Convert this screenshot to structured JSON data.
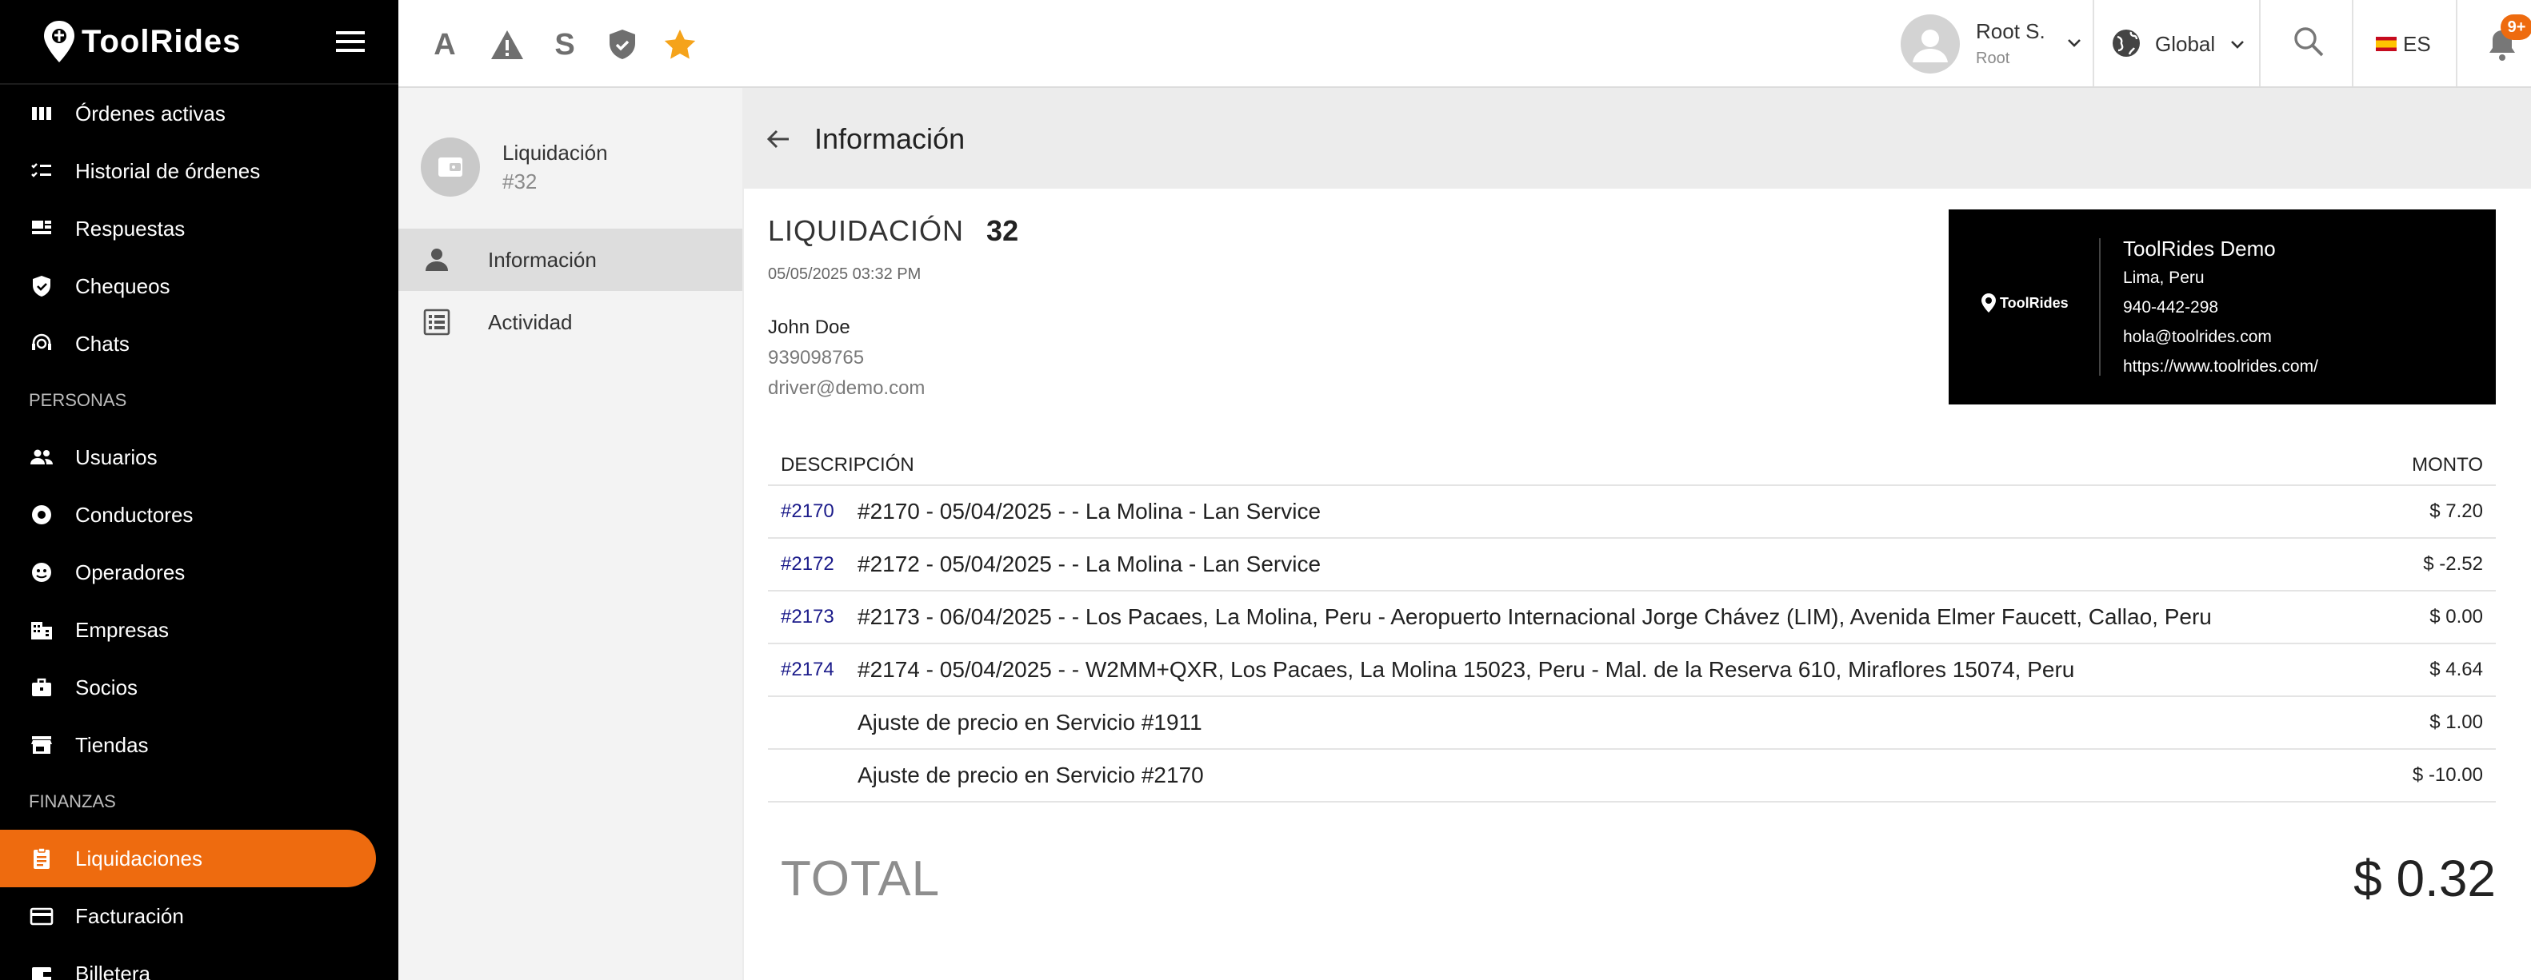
{
  "app": {
    "name": "ToolRides"
  },
  "sidebar": {
    "items_top": [
      {
        "label": "Órdenes activas",
        "icon": "columns-icon"
      },
      {
        "label": "Historial de órdenes",
        "icon": "checklist-icon"
      },
      {
        "label": "Respuestas",
        "icon": "reviews-icon"
      },
      {
        "label": "Chequeos",
        "icon": "shield-check-icon"
      },
      {
        "label": "Chats",
        "icon": "support-agent-icon"
      }
    ],
    "section_people": "PERSONAS",
    "items_people": [
      {
        "label": "Usuarios",
        "icon": "people-icon"
      },
      {
        "label": "Conductores",
        "icon": "steering-wheel-icon"
      },
      {
        "label": "Operadores",
        "icon": "headset-icon"
      },
      {
        "label": "Empresas",
        "icon": "building-icon"
      },
      {
        "label": "Socios",
        "icon": "briefcase-icon"
      },
      {
        "label": "Tiendas",
        "icon": "store-icon"
      }
    ],
    "section_finance": "FINANZAS",
    "items_finance": [
      {
        "label": "Liquidaciones",
        "icon": "receipt-icon",
        "active": true
      },
      {
        "label": "Facturación",
        "icon": "credit-card-icon"
      },
      {
        "label": "Billetera",
        "icon": "wallet-icon"
      }
    ]
  },
  "topbar": {
    "letters": [
      "A",
      "S"
    ],
    "user": {
      "name": "Root S.",
      "role": "Root"
    },
    "region": "Global",
    "language": "ES",
    "notifications_badge": "9+"
  },
  "subpanel": {
    "title": "Liquidación",
    "number": "#32",
    "items": [
      {
        "label": "Información",
        "active": true
      },
      {
        "label": "Actividad"
      }
    ]
  },
  "page": {
    "title": "Información"
  },
  "settlement": {
    "label": "LIQUIDACIÓN",
    "number": "32",
    "date": "05/05/2025 03:32 PM",
    "driver": {
      "name": "John Doe",
      "phone": "939098765",
      "email": "driver@demo.com"
    },
    "company": {
      "name": "ToolRides Demo",
      "city": "Lima, Peru",
      "phone": "940-442-298",
      "email": "hola@toolrides.com",
      "website": "https://www.toolrides.com/",
      "logo_text": "ToolRides"
    },
    "columns": {
      "description": "DESCRIPCIÓN",
      "amount": "MONTO"
    },
    "rows": [
      {
        "ref": "#2170",
        "description": "#2170 - 05/04/2025 - - La Molina - Lan Service",
        "amount": "$ 7.20"
      },
      {
        "ref": "#2172",
        "description": "#2172 - 05/04/2025 - - La Molina - Lan Service",
        "amount": "$ -2.52"
      },
      {
        "ref": "#2173",
        "description": "#2173 - 06/04/2025 - - Los Pacaes, La Molina, Peru - Aeropuerto Internacional Jorge Chávez (LIM), Avenida Elmer Faucett, Callao, Peru",
        "amount": "$ 0.00"
      },
      {
        "ref": "#2174",
        "description": "#2174 - 05/04/2025 - - W2MM+QXR, Los Pacaes, La Molina 15023, Peru - Mal. de la Reserva 610, Miraflores 15074, Peru",
        "amount": "$ 4.64"
      },
      {
        "ref": "",
        "description": "Ajuste de precio en Servicio #1911",
        "amount": "$ 1.00"
      },
      {
        "ref": "",
        "description": "Ajuste de precio en Servicio #2170",
        "amount": "$ -10.00"
      }
    ],
    "total_label": "TOTAL",
    "total_value": "$ 0.32"
  },
  "colors": {
    "accent": "#ee6b0f",
    "star": "#f5a31a",
    "link": "#1b1b8a",
    "sidebar_bg": "#000000"
  }
}
